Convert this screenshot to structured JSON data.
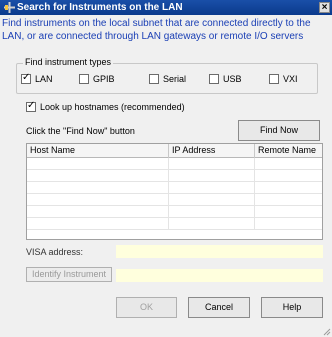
{
  "window": {
    "title": "Search for Instruments on the LAN",
    "close_label": "×"
  },
  "description": "Find instruments on the local subnet that are connected directly to the LAN, or are connected through LAN gateways or remote I/O servers",
  "instrument_types": {
    "legend": "Find instrument types",
    "options": [
      {
        "label": "LAN",
        "checked": true
      },
      {
        "label": "GPIB",
        "checked": false
      },
      {
        "label": "Serial",
        "checked": false
      },
      {
        "label": "USB",
        "checked": false
      },
      {
        "label": "VXI",
        "checked": false
      }
    ]
  },
  "lookup_hostnames": {
    "label": "Look up hostnames (recommended)",
    "checked": true
  },
  "find_now": {
    "instruction": "Click the \"Find Now\" button",
    "button_label": "Find Now"
  },
  "results_table": {
    "columns": [
      "Host Name",
      "IP Address",
      "Remote Name"
    ],
    "rows": []
  },
  "visa": {
    "label": "VISA address:",
    "value": ""
  },
  "identify": {
    "button_label": "Identify Instrument",
    "value": ""
  },
  "footer": {
    "ok_label": "OK",
    "cancel_label": "Cancel",
    "help_label": "Help"
  }
}
